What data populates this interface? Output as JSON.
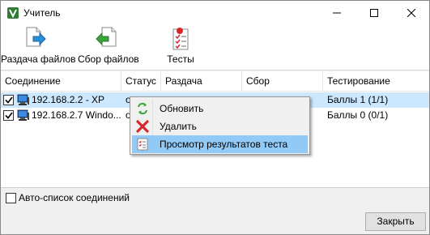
{
  "window": {
    "title": "Учитель"
  },
  "toolbar": {
    "distribute_label": "Раздача файлов",
    "collect_label": "Сбор файлов",
    "tests_label": "Тесты"
  },
  "list": {
    "columns": [
      "Соединение",
      "Статус",
      "Раздача",
      "Сбор",
      "Тестирование"
    ],
    "rows": [
      {
        "checked": true,
        "connection": "192.168.2.2 - XP",
        "status": "o",
        "testing": "Баллы 1  (1/1)"
      },
      {
        "checked": true,
        "connection": "192.168.2.7 Windo...",
        "status": "o",
        "testing": "Баллы 0  (0/1)"
      }
    ]
  },
  "context_menu": {
    "items": [
      {
        "label": "Обновить",
        "icon": "refresh-icon"
      },
      {
        "label": "Удалить",
        "icon": "delete-icon"
      },
      {
        "label": "Просмотр результатов теста",
        "icon": "test-results-icon"
      }
    ]
  },
  "bottom": {
    "auto_list_label": "Авто-список соединений",
    "close_label": "Закрыть"
  },
  "colors": {
    "selection": "#cce8ff",
    "menu_highlight": "#91c9f7",
    "delete_red": "#d9262b",
    "refresh_green": "#3aa63a"
  }
}
